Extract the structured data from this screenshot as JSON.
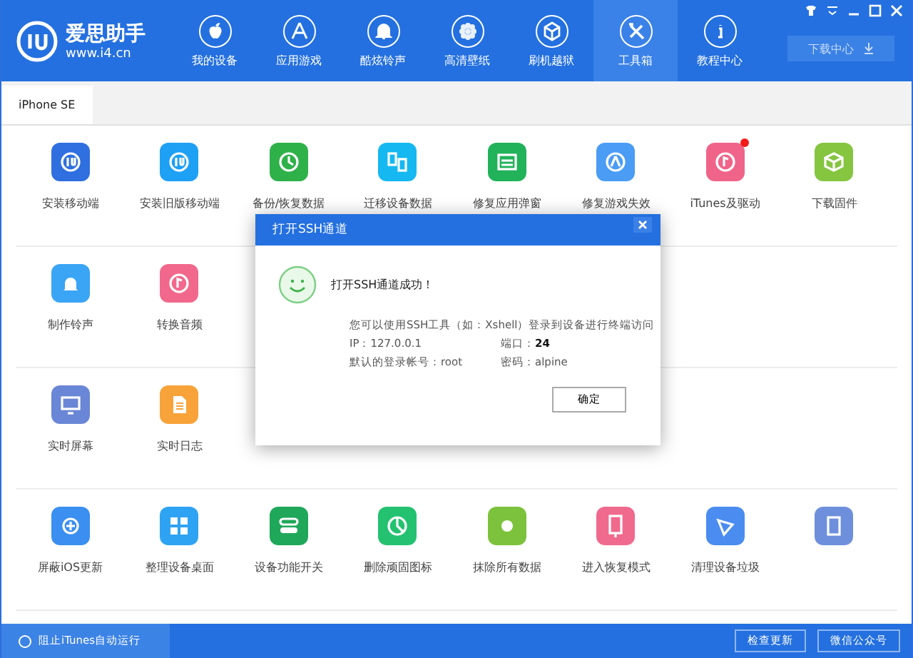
{
  "app": {
    "logo_name": "爱思助手",
    "logo_url": "www.i4.cn"
  },
  "nav": [
    {
      "label": "我的设备",
      "selected": false
    },
    {
      "label": "应用游戏",
      "selected": false
    },
    {
      "label": "酷炫铃声",
      "selected": false
    },
    {
      "label": "高清壁纸",
      "selected": false
    },
    {
      "label": "刷机越狱",
      "selected": false
    },
    {
      "label": "工具箱",
      "selected": true
    },
    {
      "label": "教程中心",
      "selected": false
    }
  ],
  "download_button": "下载中心",
  "device_tabs": [
    {
      "label": "iPhone SE",
      "selected": true
    }
  ],
  "tool_rows": [
    {
      "items": [
        {
          "label": "安装移动端",
          "color": "#2f6fe0"
        },
        {
          "label": "安装旧版移动端",
          "color": "#1ea0f5"
        },
        {
          "label": "备份/恢复数据",
          "color": "#2fb14a"
        },
        {
          "label": "迁移设备数据",
          "color": "#15b8f0"
        },
        {
          "label": "修复应用弹窗",
          "color": "#21b25a"
        },
        {
          "label": "修复游戏失效",
          "color": "#4a9cf5"
        },
        {
          "label": "iTunes及驱动",
          "color": "#f0648a",
          "badge": true
        },
        {
          "label": "下载固件",
          "color": "#85c540"
        }
      ]
    },
    {
      "items": [
        {
          "label": "制作铃声",
          "color": "#3aa4f5"
        },
        {
          "label": "转换音频",
          "color": "#f2688c"
        }
      ]
    },
    {
      "items": [
        {
          "label": "实时屏幕",
          "color": "#6a86d6"
        },
        {
          "label": "实时日志",
          "color": "#f7a33a"
        }
      ]
    },
    {
      "items": [
        {
          "label": "屏蔽iOS更新",
          "color": "#3a8ff0"
        },
        {
          "label": "整理设备桌面",
          "color": "#2fa3f3"
        },
        {
          "label": "设备功能开关",
          "color": "#1fa85a"
        },
        {
          "label": "删除顽固图标",
          "color": "#24c270"
        },
        {
          "label": "抹除所有数据",
          "color": "#7cc23c"
        },
        {
          "label": "进入恢复模式",
          "color": "#f06a8e"
        },
        {
          "label": "清理设备垃圾",
          "color": "#4a8cf0"
        },
        {
          "color": "#6e90dc"
        }
      ]
    }
  ],
  "dialog": {
    "title": "打开SSH通道",
    "heading": "打开SSH通道成功！",
    "message": "您可以使用SSH工具（如：Xshell）登录到设备进行终端访问",
    "ip": "IP：127.0.0.1",
    "port_label": "端口：",
    "port": "24",
    "account": "默认的登录帐号：root",
    "password": "密码：alpine",
    "ok_button": "确定"
  },
  "status_bar": {
    "itunes_block": {
      "label": "阻止iTunes自动运行",
      "checked": false
    },
    "buttons": [
      "检查更新",
      "微信公众号"
    ]
  }
}
